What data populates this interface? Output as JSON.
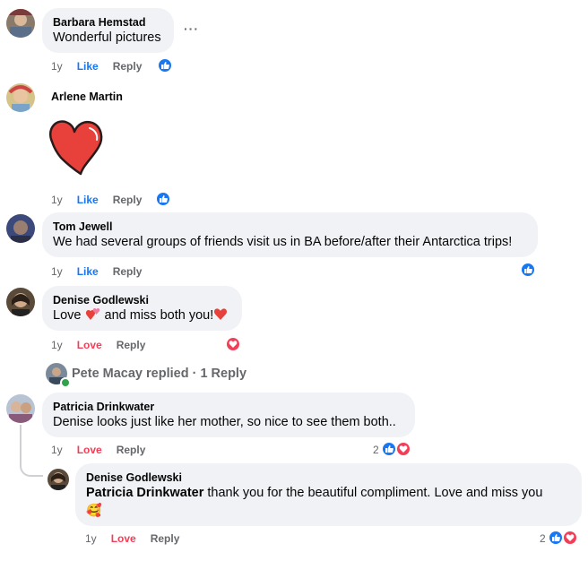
{
  "comments": [
    {
      "name": "Barbara Hemstad",
      "text": "Wonderful pictures",
      "time": "1y",
      "action1": "Like",
      "reply": "Reply"
    },
    {
      "name": "Arlene Martin",
      "text": "",
      "time": "1y",
      "action1": "Like",
      "reply": "Reply"
    },
    {
      "name": "Tom Jewell",
      "text": "We had several groups of friends visit us in BA before/after their Antarctica trips!",
      "time": "1y",
      "action1": "Like",
      "reply": "Reply"
    },
    {
      "name": "Denise Godlewski",
      "text_a": "Love ",
      "text_b": " and miss both you!",
      "time": "1y",
      "action1": "Love",
      "reply": "Reply"
    },
    {
      "name": "Patricia Drinkwater",
      "text": "Denise looks just like her mother, so nice to see them both..",
      "time": "1y",
      "action1": "Love",
      "reply": "Reply",
      "reaction_count": "2"
    }
  ],
  "replies_link": {
    "text": "Pete Macay replied · 1 Reply"
  },
  "reply": {
    "name": "Denise Godlewski",
    "mention": "Patricia Drinkwater",
    "text": " thank you for the beautiful compliment. Love and miss you",
    "emoji": "🥰",
    "time": "1y",
    "action1": "Love",
    "reply": "Reply",
    "reaction_count": "2"
  },
  "more_options": "···",
  "icons": {
    "like": "thumbs-up-icon",
    "love": "heart-icon",
    "more": "more-options-icon"
  },
  "colors": {
    "like": "#1877f2",
    "love": "#f33e58",
    "bubble": "#f0f2f5",
    "meta": "#65676b"
  }
}
